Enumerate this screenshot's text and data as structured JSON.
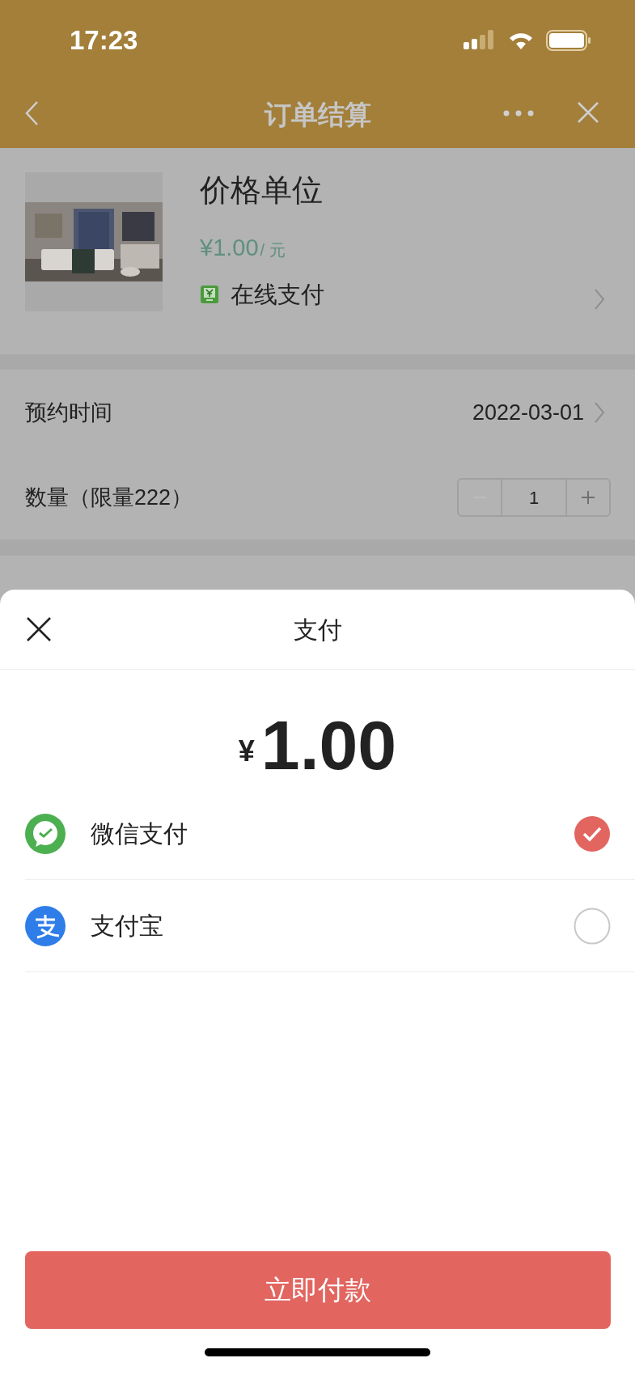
{
  "status_bar": {
    "time": "17:23"
  },
  "nav_bar": {
    "title": "订单结算"
  },
  "product": {
    "title": "价格单位",
    "price": "¥1.00",
    "unit": "/ 元",
    "payment_label": "在线支付"
  },
  "booking": {
    "label": "预约时间",
    "value": "2022-03-01"
  },
  "quantity": {
    "label": "数量（限量222）",
    "value": "1",
    "decrement_disabled": true
  },
  "payment_sheet": {
    "title": "支付",
    "currency": "¥",
    "amount": "1.00",
    "methods": [
      {
        "kind": "wechat",
        "name": "微信支付",
        "selected": true
      },
      {
        "kind": "alipay",
        "name": "支付宝",
        "selected": false
      }
    ],
    "button": "立即付款"
  }
}
